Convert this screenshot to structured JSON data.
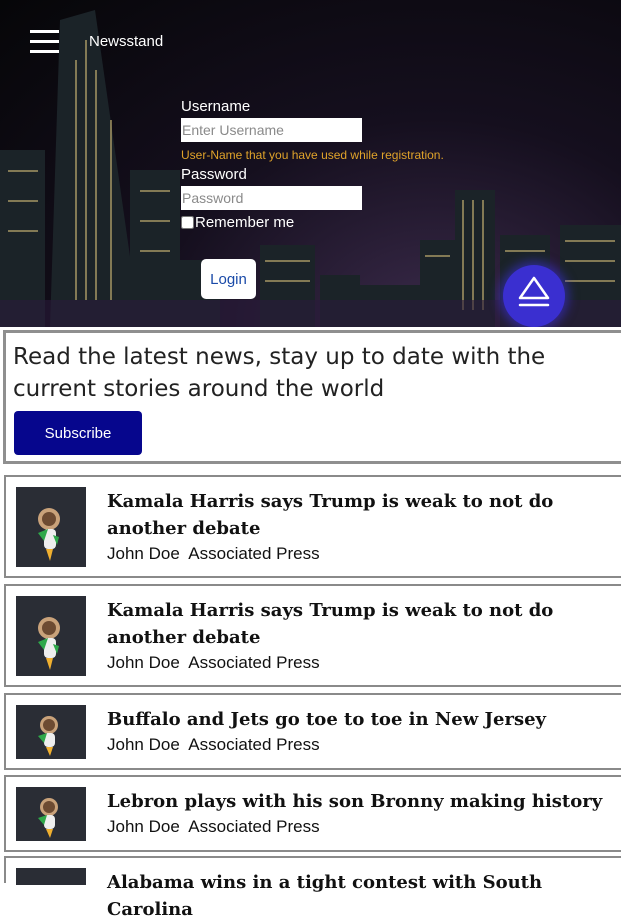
{
  "header": {
    "brand": "Newsstand",
    "menu_icon": "hamburger-menu-icon"
  },
  "login_form": {
    "username_label": "Username",
    "username_placeholder": "Enter Username",
    "username_hint": "User-Name that you have used while registration.",
    "password_label": "Password",
    "password_placeholder": "Password",
    "remember_label": "Remember me",
    "login_button": "Login"
  },
  "scroll_top_icon": "eject-up-icon",
  "subscribe": {
    "text": "Read the latest news, stay up to date with the current stories around the world",
    "button": "Subscribe"
  },
  "articles": [
    {
      "title": "Kamala Harris says Trump is weak to not do another debate",
      "author": "John Doe",
      "source": "Associated Press"
    },
    {
      "title": "Kamala Harris says Trump is weak to not do another debate",
      "author": "John Doe",
      "source": "Associated Press"
    },
    {
      "title": "Buffalo and Jets go toe to toe in New Jersey",
      "author": "John Doe",
      "source": "Associated Press"
    },
    {
      "title": "Lebron plays with his son Bronny making history",
      "author": "John Doe",
      "source": "Associated Press"
    },
    {
      "title": "Alabama wins in a tight contest with South Carolina",
      "author": "",
      "source": ""
    }
  ],
  "colors": {
    "subscribe_button": "#06068d",
    "hint": "#e0a32a",
    "fab": "#3a2fd0"
  }
}
